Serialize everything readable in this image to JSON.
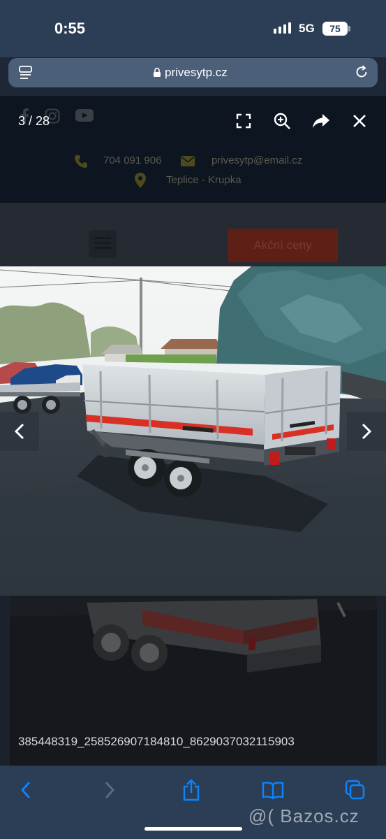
{
  "status": {
    "time": "0:55",
    "network": "5G",
    "battery": "75"
  },
  "browser": {
    "url": "privesytp.cz"
  },
  "site": {
    "phone": "704 091 906",
    "email": "privesytp@email.cz",
    "location": "Teplice - Krupka",
    "promo_button": "Akční ceny"
  },
  "lightbox": {
    "counter": "3 / 28",
    "filename": "385448319_258526907184810_8629037032115903"
  },
  "watermark": "@( Bazos.cz",
  "icons": {
    "toolbar": [
      "fullscreen-icon",
      "zoom-in-icon",
      "share-icon",
      "close-icon"
    ],
    "nav": [
      "chevron-left-icon",
      "chevron-right-icon"
    ],
    "bottom": [
      "back-icon",
      "forward-icon",
      "share-icon",
      "bookmarks-icon",
      "tabs-icon"
    ]
  },
  "colors": {
    "accent_red": "#d93025",
    "ios_blue": "#0a84ff",
    "bar_bg": "#2c3e55"
  }
}
